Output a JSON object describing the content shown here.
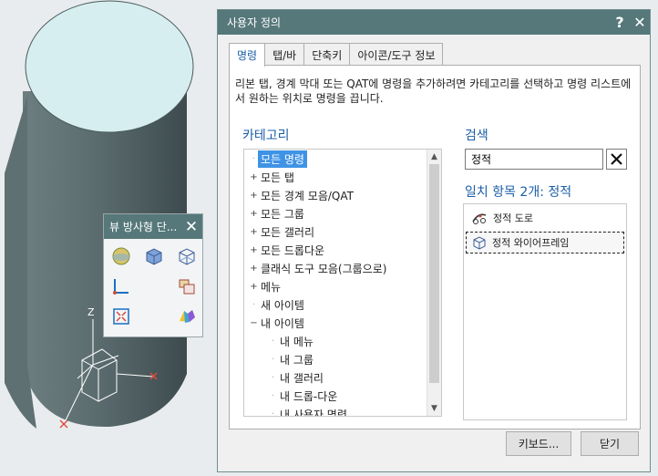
{
  "viewport": {
    "axis_label": "Z",
    "colors": {
      "background": "#e9ecee",
      "cylinder": "#56676a",
      "cylinder_top": "#d6eef0"
    }
  },
  "view_popup": {
    "title": "뷰 방사형 단...",
    "icons": [
      "shaded-sphere-icon",
      "shaded-cube-icon",
      "wireframe-cube-icon",
      "axis-view-icon",
      "",
      "section-view-icon",
      "fit-view-icon",
      "",
      "color-strip-icon"
    ]
  },
  "dialog": {
    "title": "사용자 정의",
    "help_label": "?",
    "close_label": "✕",
    "tabs": [
      {
        "label": "명령",
        "active": true
      },
      {
        "label": "탭/바",
        "active": false
      },
      {
        "label": "단축키",
        "active": false
      },
      {
        "label": "아이콘/도구 정보",
        "active": false
      }
    ],
    "description": "리본 탭, 경계 막대 또는 QAT에 명령을 추가하려면 카테고리를 선택하고 명령 리스트에서 원하는 위치로 명령을 끕니다.",
    "category_label": "카테고리",
    "search_label": "검색",
    "tree": [
      {
        "label": "모든 명령",
        "expander": "",
        "indent": 0,
        "selected": true
      },
      {
        "label": "모든 탭",
        "expander": "+",
        "indent": 0
      },
      {
        "label": "모든 경계 모음/QAT",
        "expander": "+",
        "indent": 0
      },
      {
        "label": "모든 그룹",
        "expander": "+",
        "indent": 0
      },
      {
        "label": "모든 갤러리",
        "expander": "+",
        "indent": 0
      },
      {
        "label": "모든 드롭다운",
        "expander": "+",
        "indent": 0
      },
      {
        "label": "클래식 도구 모음(그룹으로)",
        "expander": "+",
        "indent": 0
      },
      {
        "label": "메뉴",
        "expander": "+",
        "indent": 0
      },
      {
        "label": "새 아이템",
        "expander": "",
        "indent": 0
      },
      {
        "label": "내 아이템",
        "expander": "−",
        "indent": 0
      },
      {
        "label": "내 메뉴",
        "expander": "",
        "indent": 1
      },
      {
        "label": "내 그룹",
        "expander": "",
        "indent": 1
      },
      {
        "label": "내 갤러리",
        "expander": "",
        "indent": 1
      },
      {
        "label": "내 드롭-다운",
        "expander": "",
        "indent": 1
      },
      {
        "label": "내 사용자 명령",
        "expander": "",
        "indent": 1
      }
    ],
    "search_value": "정적",
    "results_label": "일치 항목 2개: 정적",
    "results": [
      {
        "label": "정적 도로",
        "icon": "road-icon",
        "focused": false
      },
      {
        "label": "정적 와이어프레임",
        "icon": "wireframe-cube-icon",
        "focused": true
      }
    ],
    "keyboard_button": "키보드...",
    "close_button": "닫기"
  }
}
